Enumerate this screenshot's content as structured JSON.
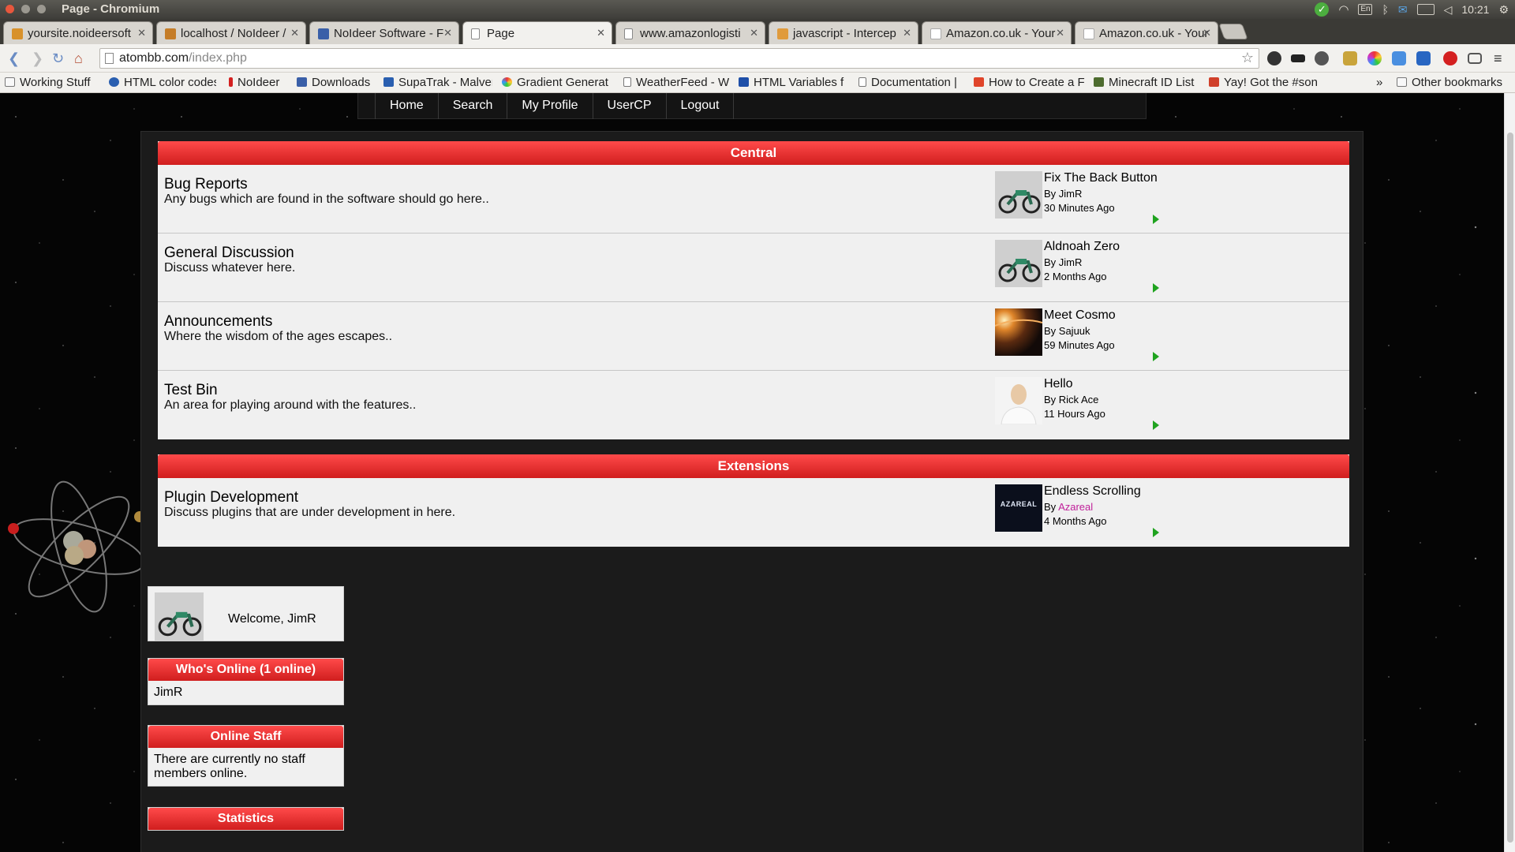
{
  "window": {
    "title": "Page - Chromium",
    "clock": "10:21",
    "lang": "En"
  },
  "tabs": [
    {
      "label": "yoursite.noideersoft",
      "active": false
    },
    {
      "label": "localhost / NoIdeer /",
      "active": false
    },
    {
      "label": "NoIdeer Software - F",
      "active": false
    },
    {
      "label": "Page",
      "active": true
    },
    {
      "label": "www.amazonlogisti",
      "active": false
    },
    {
      "label": "javascript - Intercep",
      "active": false
    },
    {
      "label": "Amazon.co.uk - Your",
      "active": false
    },
    {
      "label": "Amazon.co.uk - Your",
      "active": false
    }
  ],
  "omnibox": {
    "domain": "atombb.com",
    "path": "/index.php"
  },
  "bookmarks": [
    {
      "label": "Working Stuff"
    },
    {
      "label": "HTML color codes"
    },
    {
      "label": "NoIdeer"
    },
    {
      "label": "Downloads"
    },
    {
      "label": "SupaTrak - Malver"
    },
    {
      "label": "Gradient Generat"
    },
    {
      "label": "WeatherFeed - W"
    },
    {
      "label": "HTML Variables f"
    },
    {
      "label": "Documentation |"
    },
    {
      "label": "How to Create a F"
    },
    {
      "label": "Minecraft ID List"
    },
    {
      "label": "Yay! Got the #son"
    }
  ],
  "bookmarks_more": "»",
  "other_bookmarks": "Other bookmarks",
  "nav": {
    "home": "Home",
    "search": "Search",
    "profile": "My Profile",
    "usercp": "UserCP",
    "logout": "Logout"
  },
  "categories": [
    {
      "name": "Central",
      "forums": [
        {
          "name": "Bug Reports",
          "desc": "Any bugs which are found in the software should go here..",
          "lp_title": "Fix The Back Button",
          "lp_by": "By JimR",
          "lp_time": "30 Minutes Ago"
        },
        {
          "name": "General Discussion",
          "desc": "Discuss whatever here.",
          "lp_title": "Aldnoah Zero",
          "lp_by": "By JimR",
          "lp_time": "2 Months Ago"
        },
        {
          "name": "Announcements",
          "desc": "Where the wisdom of the ages escapes..",
          "lp_title": "Meet Cosmo",
          "lp_by": "By Sajuuk",
          "lp_time": "59 Minutes Ago"
        },
        {
          "name": "Test Bin",
          "desc": "An area for playing around with the features..",
          "lp_title": "Hello",
          "lp_by": "By Rick Ace",
          "lp_time": "11 Hours Ago"
        }
      ]
    },
    {
      "name": "Extensions",
      "forums": [
        {
          "name": "Plugin Development",
          "desc": "Discuss plugins that are under development in here.",
          "lp_title": "Endless Scrolling",
          "lp_by_prefix": "By",
          "lp_by_user": "Azareal",
          "lp_time": "4 Months Ago",
          "thumb_text": "AZAREAL"
        }
      ]
    }
  ],
  "sidebar": {
    "welcome": "Welcome, JimR",
    "online_title": "Who's Online (1 online)",
    "online_users": "JimR",
    "staff_title": "Online Staff",
    "staff_body": "There are currently no staff members online.",
    "stats_title": "Statistics"
  },
  "colors": {
    "accent_red": "#e02a2a",
    "arrow_green": "#1fa31f",
    "nav_bg": "#141414"
  }
}
